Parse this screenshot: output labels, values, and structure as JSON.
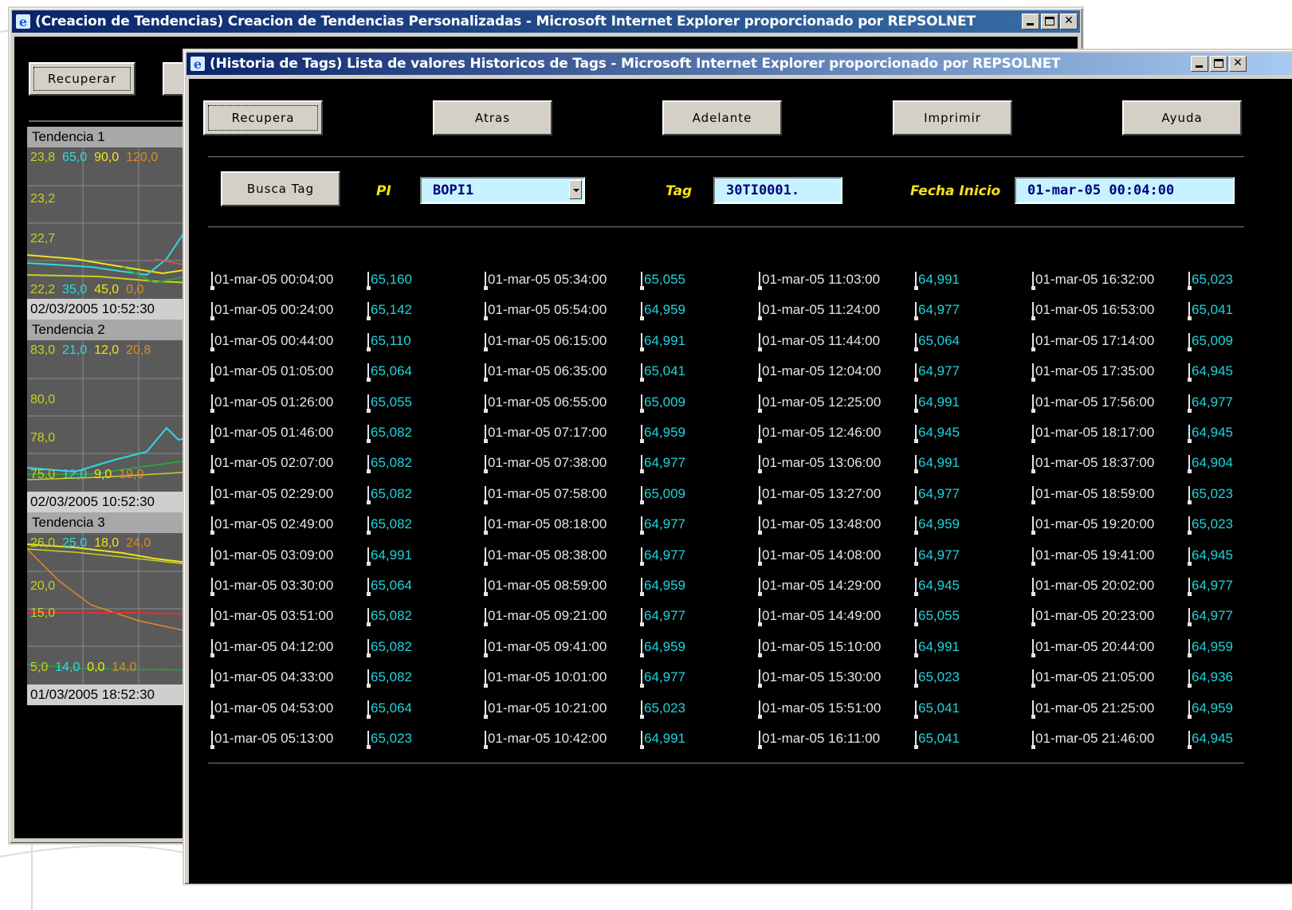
{
  "back_window": {
    "title": "(Creacion de Tendencias) Creacion de Tendencias Personalizadas - Microsoft Internet Explorer proporcionado por REPSOLNET",
    "recuperar_label": "Recuperar",
    "trends": [
      {
        "name": "Tendencia 1",
        "top_labels": [
          {
            "text": "23,8",
            "color": "#c8d020"
          },
          {
            "text": "65,0",
            "color": "#30d8e0"
          },
          {
            "text": "90,0",
            "color": "#f2e21a"
          },
          {
            "text": "120,0",
            "color": "#e08a20"
          }
        ],
        "axis_labels": [
          "23,2",
          "22,7"
        ],
        "bottom_labels": [
          {
            "text": "22,2",
            "color": "#c8d020"
          },
          {
            "text": "35,0",
            "color": "#30d8e0"
          },
          {
            "text": "45,0",
            "color": "#f2e21a"
          },
          {
            "text": "0,0",
            "color": "#e08a20"
          }
        ],
        "timestamp": "02/03/2005 10:52:30"
      },
      {
        "name": "Tendencia 2",
        "top_labels": [
          {
            "text": "83,0",
            "color": "#c8d020"
          },
          {
            "text": "21,0",
            "color": "#30d8e0"
          },
          {
            "text": "12,0",
            "color": "#f2e21a"
          },
          {
            "text": "20,8",
            "color": "#e08a20"
          }
        ],
        "axis_labels": [
          "80,0",
          "78,0"
        ],
        "bottom_labels": [
          {
            "text": "75,0",
            "color": "#c8d020"
          },
          {
            "text": "12,0",
            "color": "#30d8e0"
          },
          {
            "text": "9,0",
            "color": "#f2e21a"
          },
          {
            "text": "19,0",
            "color": "#e08a20"
          }
        ],
        "timestamp": "02/03/2005 10:52:30"
      },
      {
        "name": "Tendencia 3",
        "top_labels": [
          {
            "text": "26,0",
            "color": "#c8d020"
          },
          {
            "text": "25,0",
            "color": "#30d8e0"
          },
          {
            "text": "18,0",
            "color": "#f2e21a"
          },
          {
            "text": "24,0",
            "color": "#e08a20"
          }
        ],
        "axis_labels": [
          "20,0",
          "15,0"
        ],
        "bottom_labels": [
          {
            "text": "5,0",
            "color": "#c8d020"
          },
          {
            "text": "14,0",
            "color": "#30d8e0"
          },
          {
            "text": "0,0",
            "color": "#f2e21a"
          },
          {
            "text": "14,0",
            "color": "#e08a20"
          }
        ],
        "timestamp": "01/03/2005 18:52:30"
      }
    ]
  },
  "front_window": {
    "title": "(Historia de Tags) Lista de valores Historicos de Tags - Microsoft Internet Explorer proporcionado por REPSOLNET",
    "toolbar": {
      "recupera": "Recupera",
      "atras": "Atras",
      "adelante": "Adelante",
      "imprimir": "Imprimir",
      "ayuda": "Ayuda"
    },
    "search": {
      "busca_tag": "Busca Tag",
      "pi_label": "PI",
      "pi_value": "BOPI1",
      "tag_label": "Tag",
      "tag_value": "30TI0001.",
      "fecha_label": "Fecha Inicio",
      "fecha_value": "01-mar-05 00:04:00"
    },
    "columns": [
      [
        [
          "01-mar-05 00:04:00",
          "65,160"
        ],
        [
          "01-mar-05 00:24:00",
          "65,142"
        ],
        [
          "01-mar-05 00:44:00",
          "65,110"
        ],
        [
          "01-mar-05 01:05:00",
          "65,064"
        ],
        [
          "01-mar-05 01:26:00",
          "65,055"
        ],
        [
          "01-mar-05 01:46:00",
          "65,082"
        ],
        [
          "01-mar-05 02:07:00",
          "65,082"
        ],
        [
          "01-mar-05 02:29:00",
          "65,082"
        ],
        [
          "01-mar-05 02:49:00",
          "65,082"
        ],
        [
          "01-mar-05 03:09:00",
          "64,991"
        ],
        [
          "01-mar-05 03:30:00",
          "65,064"
        ],
        [
          "01-mar-05 03:51:00",
          "65,082"
        ],
        [
          "01-mar-05 04:12:00",
          "65,082"
        ],
        [
          "01-mar-05 04:33:00",
          "65,082"
        ],
        [
          "01-mar-05 04:53:00",
          "65,064"
        ],
        [
          "01-mar-05 05:13:00",
          "65,023"
        ]
      ],
      [
        [
          "01-mar-05 05:34:00",
          "65,055"
        ],
        [
          "01-mar-05 05:54:00",
          "64,959"
        ],
        [
          "01-mar-05 06:15:00",
          "64,991"
        ],
        [
          "01-mar-05 06:35:00",
          "65,041"
        ],
        [
          "01-mar-05 06:55:00",
          "65,009"
        ],
        [
          "01-mar-05 07:17:00",
          "64,959"
        ],
        [
          "01-mar-05 07:38:00",
          "64,977"
        ],
        [
          "01-mar-05 07:58:00",
          "65,009"
        ],
        [
          "01-mar-05 08:18:00",
          "64,977"
        ],
        [
          "01-mar-05 08:38:00",
          "64,977"
        ],
        [
          "01-mar-05 08:59:00",
          "64,959"
        ],
        [
          "01-mar-05 09:21:00",
          "64,977"
        ],
        [
          "01-mar-05 09:41:00",
          "64,959"
        ],
        [
          "01-mar-05 10:01:00",
          "64,977"
        ],
        [
          "01-mar-05 10:21:00",
          "65,023"
        ],
        [
          "01-mar-05 10:42:00",
          "64,991"
        ]
      ],
      [
        [
          "01-mar-05 11:03:00",
          "64,991"
        ],
        [
          "01-mar-05 11:24:00",
          "64,977"
        ],
        [
          "01-mar-05 11:44:00",
          "65,064"
        ],
        [
          "01-mar-05 12:04:00",
          "64,977"
        ],
        [
          "01-mar-05 12:25:00",
          "64,991"
        ],
        [
          "01-mar-05 12:46:00",
          "64,945"
        ],
        [
          "01-mar-05 13:06:00",
          "64,991"
        ],
        [
          "01-mar-05 13:27:00",
          "64,977"
        ],
        [
          "01-mar-05 13:48:00",
          "64,959"
        ],
        [
          "01-mar-05 14:08:00",
          "64,977"
        ],
        [
          "01-mar-05 14:29:00",
          "64,945"
        ],
        [
          "01-mar-05 14:49:00",
          "65,055"
        ],
        [
          "01-mar-05 15:10:00",
          "64,991"
        ],
        [
          "01-mar-05 15:30:00",
          "65,023"
        ],
        [
          "01-mar-05 15:51:00",
          "65,041"
        ],
        [
          "01-mar-05 16:11:00",
          "65,041"
        ]
      ],
      [
        [
          "01-mar-05 16:32:00",
          "65,023"
        ],
        [
          "01-mar-05 16:53:00",
          "65,041"
        ],
        [
          "01-mar-05 17:14:00",
          "65,009"
        ],
        [
          "01-mar-05 17:35:00",
          "64,945"
        ],
        [
          "01-mar-05 17:56:00",
          "64,977"
        ],
        [
          "01-mar-05 18:17:00",
          "64,945"
        ],
        [
          "01-mar-05 18:37:00",
          "64,904"
        ],
        [
          "01-mar-05 18:59:00",
          "65,023"
        ],
        [
          "01-mar-05 19:20:00",
          "65,023"
        ],
        [
          "01-mar-05 19:41:00",
          "64,945"
        ],
        [
          "01-mar-05 20:02:00",
          "64,977"
        ],
        [
          "01-mar-05 20:23:00",
          "64,977"
        ],
        [
          "01-mar-05 20:44:00",
          "64,959"
        ],
        [
          "01-mar-05 21:05:00",
          "64,936"
        ],
        [
          "01-mar-05 21:25:00",
          "64,959"
        ],
        [
          "01-mar-05 21:46:00",
          "64,945"
        ]
      ]
    ]
  }
}
